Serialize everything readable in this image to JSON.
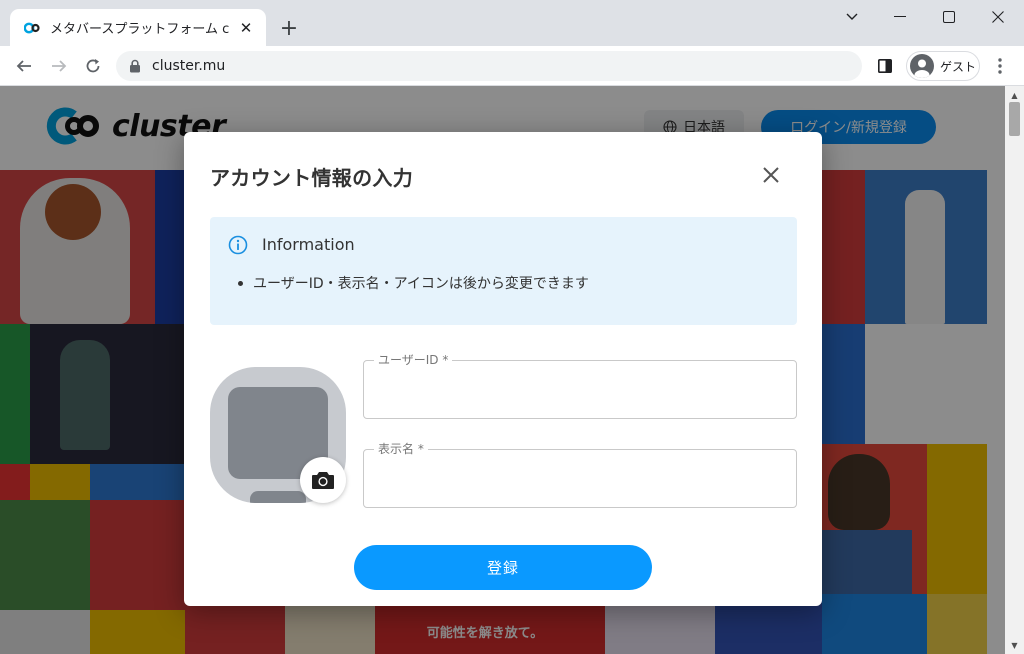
{
  "browser": {
    "tab": {
      "title": "メタバースプラットフォーム cluster（ク",
      "favicon": "cluster-favicon-icon"
    },
    "new_tab_label": "+",
    "address_bar": {
      "url": "cluster.mu",
      "icon": "lock-icon"
    },
    "profile": {
      "label": "ゲスト"
    }
  },
  "site": {
    "logo_text": "cluster",
    "language_button": "日本語",
    "login_button": "ログイン/新規登録",
    "banner_text": "可能性を解き放て。"
  },
  "modal": {
    "title": "アカウント情報の入力",
    "info": {
      "title": "Information",
      "items": [
        "ユーザーID・表示名・アイコンは後から変更できます"
      ]
    },
    "fields": {
      "user_id": {
        "label": "ユーザーID *",
        "value": ""
      },
      "display_name": {
        "label": "表示名 *",
        "value": ""
      }
    },
    "submit_label": "登録"
  },
  "colors": {
    "primary": "#0a99ff",
    "info_bg": "#e6f3fc",
    "info_icon": "#1a8fe0",
    "overlay": "rgba(0,0,0,0.45)"
  }
}
